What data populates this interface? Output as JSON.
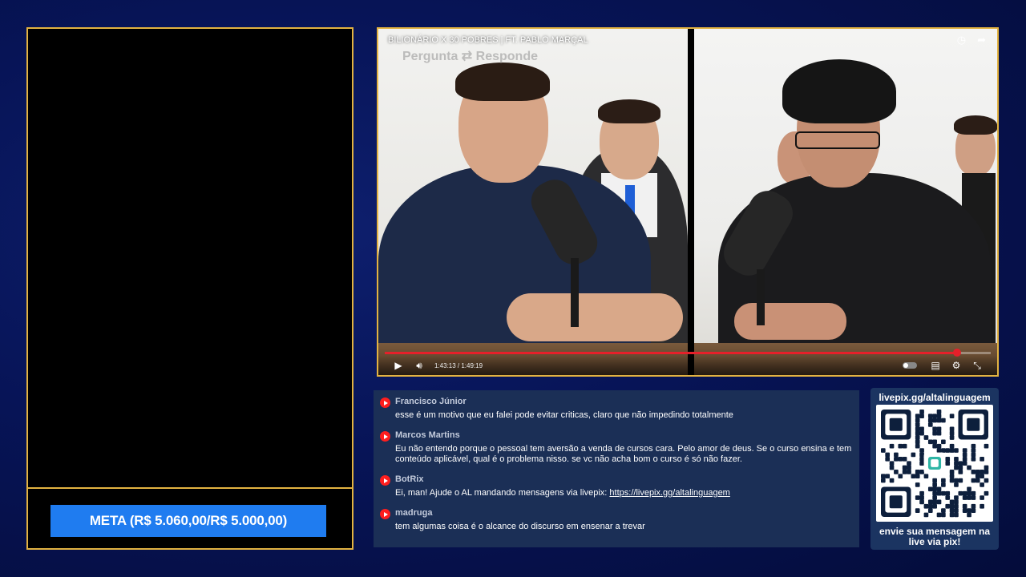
{
  "meta": {
    "label": "META (R$ 5.060,00/R$ 5.000,00)"
  },
  "video": {
    "title": "BILIONÁRIO X 30 POBRES | FT. PABLO MARÇAL",
    "subtitle": "Pergunta ⇄ Responde",
    "time": "1:43:13 / 1:49:19",
    "progress": 0.944,
    "accent": "#e5202a",
    "icons": {
      "clock": "clock-icon",
      "share": "share-icon",
      "play": "play-icon",
      "volume": "volume-icon",
      "captions": "captions-icon",
      "settings": "gear-icon",
      "exit_fullscreen": "exit-fullscreen-icon"
    }
  },
  "chat": {
    "messages": [
      {
        "author": "Francisco Júnior",
        "text": "esse é um motivo que eu falei pode evitar criticas, claro que não impedindo totalmente"
      },
      {
        "author": "Marcos Martins",
        "text": "Eu não entendo porque o pessoal tem aversão a venda de cursos cara. Pelo amor de deus. Se o curso ensina e tem conteúdo aplicável, qual é o problema nisso. se vc não acha bom o curso é só não fazer."
      },
      {
        "author": "BotRix",
        "text": "Ei, man! Ajude o AL mandando mensagens via livepix: ",
        "link": "https://livepix.gg/altalinguagem"
      },
      {
        "author": "madruga",
        "text": "tem algumas coisa é o alcance do discurso em ensenar a trevar"
      }
    ]
  },
  "pix": {
    "url": "livepix.gg/altalinguagem",
    "footer": "envie sua mensagem na live via pix!"
  },
  "colors": {
    "frame_gold": "#e3b341",
    "meta_blue": "#1f7cf0",
    "chat_bg": "#1b2f56"
  }
}
